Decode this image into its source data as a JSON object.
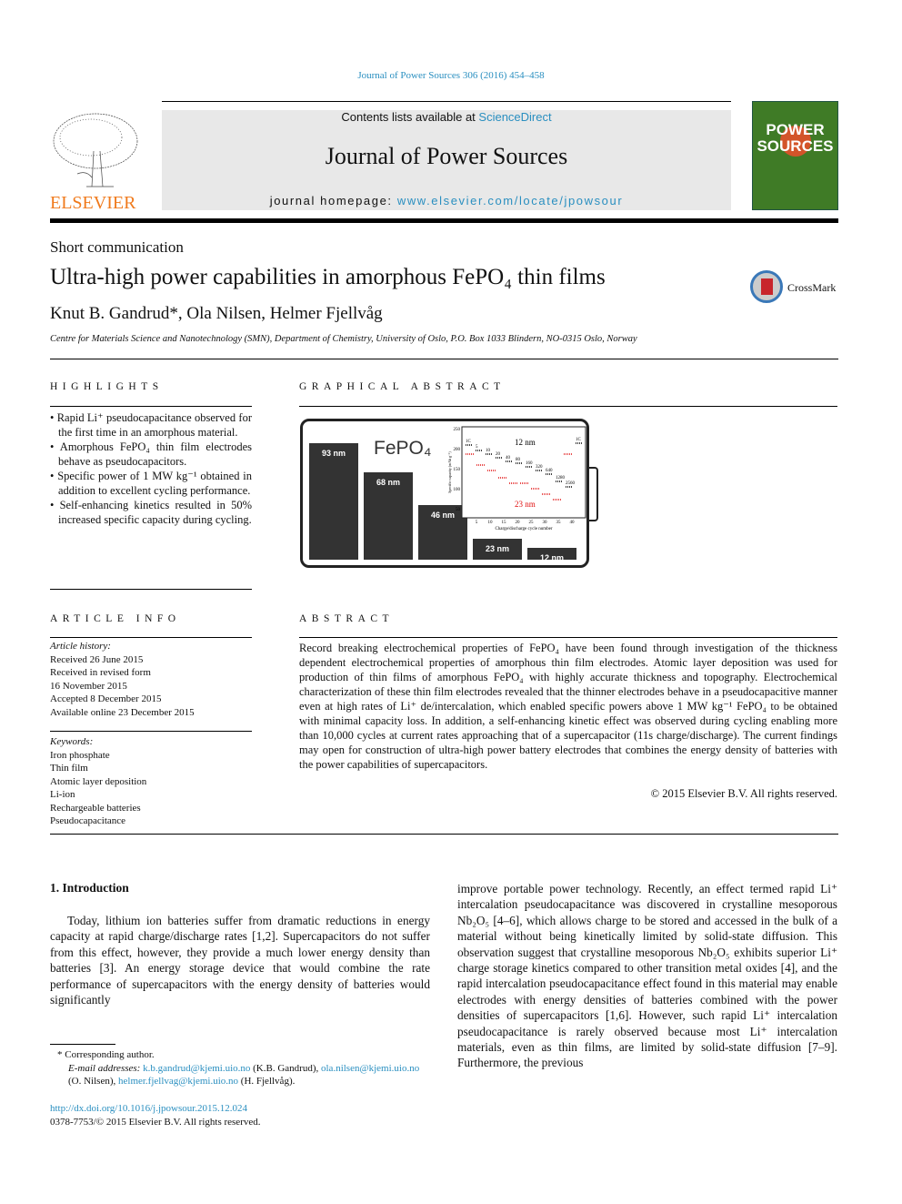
{
  "header": {
    "journal_ref": "Journal of Power Sources 306 (2016) 454–458",
    "contents_prefix": "Contents lists available at ",
    "sciencedirect": "ScienceDirect",
    "journal_title": "Journal of Power Sources",
    "homepage_prefix": "journal homepage: ",
    "homepage_url": "www.elsevier.com/locate/jpowsour",
    "publisher": "ELSEVIER",
    "cover_text": "POWER SOURCES"
  },
  "article": {
    "type": "Short communication",
    "title": "Ultra-high power capabilities in amorphous FePO₄ thin films",
    "authors": "Knut B. Gandrud*, Ola Nilsen, Helmer Fjellvåg",
    "affiliation": "Centre for Materials Science and Nanotechnology (SMN), Department of Chemistry, University of Oslo, P.O. Box 1033 Blindern, NO-0315 Oslo, Norway",
    "crossmark": "CrossMark"
  },
  "highlights": {
    "heading": "HIGHLIGHTS",
    "items": [
      "Rapid Li⁺ pseudocapacitance observed for the first time in an amorphous material.",
      "Amorphous FePO₄ thin film electrodes behave as pseudocapacitors.",
      "Specific power of 1 MW kg⁻¹ obtained in addition to excellent cycling performance.",
      "Self-enhancing kinetics resulted in 50% increased specific capacity during cycling."
    ]
  },
  "graphical_abstract": {
    "heading": "GRAPHICAL ABSTRACT",
    "formula": "FePO₄",
    "bars": [
      {
        "label": "93 nm",
        "h": 1
      },
      {
        "label": "68 nm",
        "h": 0.75
      },
      {
        "label": "46 nm",
        "h": 0.47
      },
      {
        "label": "23 nm",
        "h": 0.18
      },
      {
        "label": "12 nm",
        "h": 0.1
      }
    ],
    "inset": {
      "xlabel": "Charge/discharge cycle number",
      "ylabel": "Specific capacity (mAh g⁻¹)",
      "yticks": [
        "250",
        "200",
        "150",
        "100",
        "50"
      ],
      "xticks": [
        "5",
        "10",
        "15",
        "20",
        "25",
        "30",
        "35",
        "40"
      ],
      "series_12": "12 nm",
      "series_23": "23 nm",
      "rate_labels": [
        "1C",
        "5",
        "10",
        "20",
        "40",
        "80",
        "160",
        "320",
        "640",
        "1280",
        "2560",
        "1C"
      ],
      "color_12": "#000000",
      "color_23": "#e01010"
    }
  },
  "article_info": {
    "heading": "ARTICLE INFO",
    "history_label": "Article history:",
    "history": [
      "Received 26 June 2015",
      "Received in revised form",
      "16 November 2015",
      "Accepted 8 December 2015",
      "Available online 23 December 2015"
    ],
    "keywords_label": "Keywords:",
    "keywords": [
      "Iron phosphate",
      "Thin film",
      "Atomic layer deposition",
      "Li-ion",
      "Rechargeable batteries",
      "Pseudocapacitance"
    ]
  },
  "abstract": {
    "heading": "ABSTRACT",
    "text": "Record breaking electrochemical properties of FePO₄ have been found through investigation of the thickness dependent electrochemical properties of amorphous thin film electrodes. Atomic layer deposition was used for production of thin films of amorphous FePO₄ with highly accurate thickness and topography. Electrochemical characterization of these thin film electrodes revealed that the thinner electrodes behave in a pseudocapacitive manner even at high rates of Li⁺ de/intercalation, which enabled specific powers above 1 MW kg⁻¹ FePO₄ to be obtained with minimal capacity loss. In addition, a self-enhancing kinetic effect was observed during cycling enabling more than 10,000 cycles at current rates approaching that of a supercapacitor (11s charge/discharge). The current findings may open for construction of ultra-high power battery electrodes that combines the energy density of batteries with the power capabilities of supercapacitors.",
    "copyright": "© 2015 Elsevier B.V. All rights reserved."
  },
  "intro": {
    "heading": "1.  Introduction",
    "p1": "Today, lithium ion batteries suffer from dramatic reductions in energy capacity at rapid charge/discharge rates [1,2]. Supercapacitors do not suffer from this effect, however, they provide a much lower energy density than batteries [3]. An energy storage device that would combine the rate performance of supercapacitors with the energy density of batteries would significantly",
    "p2": "improve portable power technology. Recently, an effect termed rapid Li⁺ intercalation pseudocapacitance was discovered in crystalline mesoporous Nb₂O₅ [4–6], which allows charge to be stored and accessed in the bulk of a material without being kinetically limited by solid-state diffusion. This observation suggest that crystalline mesoporous Nb₂O₅ exhibits superior Li⁺ charge storage kinetics compared to other transition metal oxides [4], and the rapid intercalation pseudocapacitance effect found in this material may enable electrodes with energy densities of batteries combined with the power densities of supercapacitors [1,6]. However, such rapid Li⁺ intercalation pseudocapacitance is rarely observed because most Li⁺ intercalation materials, even as thin films, are limited by solid-state diffusion [7–9]. Furthermore, the previous"
  },
  "footnote": {
    "corr": "* Corresponding author.",
    "email_label": "E-mail addresses: ",
    "email1": "k.b.gandrud@kjemi.uio.no",
    "name1": " (K.B. Gandrud), ",
    "email2": "ola.nilsen@kjemi.uio.no",
    "name2": " (O. Nilsen), ",
    "email3": "helmer.fjellvag@kjemi.uio.no",
    "name3": " (H. Fjellvåg)."
  },
  "footer": {
    "doi": "http://dx.doi.org/10.1016/j.jpowsour.2015.12.024",
    "issn": "0378-7753/© 2015 Elsevier B.V. All rights reserved."
  }
}
